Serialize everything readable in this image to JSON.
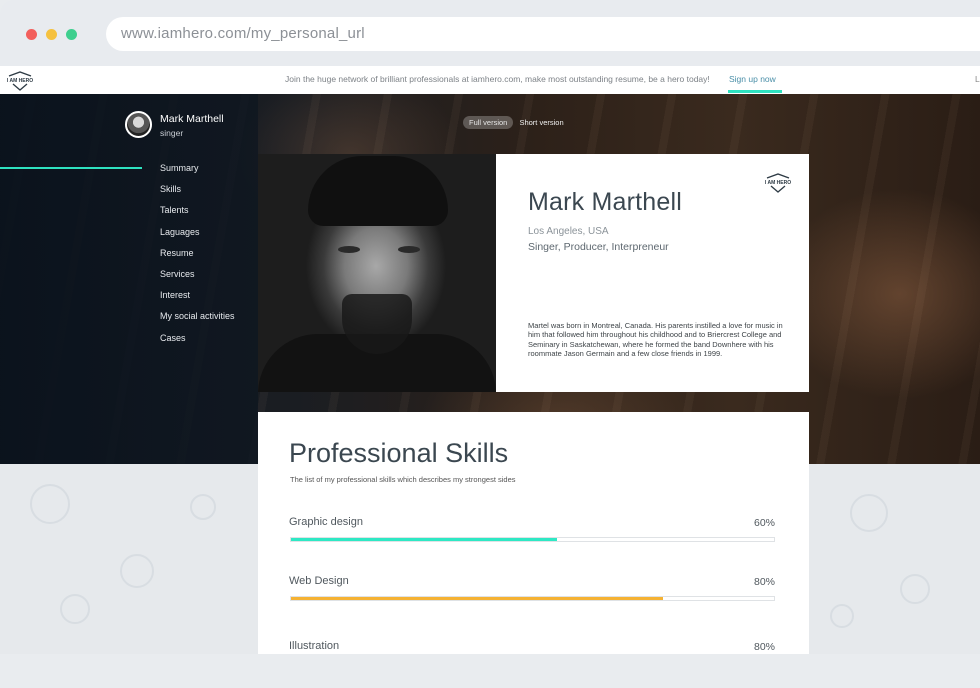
{
  "browser": {
    "url": "www.iamhero.com/my_personal_url"
  },
  "topbar": {
    "logo_text": "I AM HERO",
    "message": "Join the huge network of brilliant professionals at iamhero.com, make most outstanding resume, be a hero today!",
    "signup_label": "Sign up now",
    "right_text": "L"
  },
  "profile": {
    "name": "Mark Marthell",
    "role": "singer"
  },
  "nav": {
    "items": [
      "Summary",
      "Skills",
      "Talents",
      "Laguages",
      "Resume",
      "Services",
      "Interest",
      "My social activities",
      "Cases"
    ],
    "active": "Summary"
  },
  "version": {
    "full": "Full version",
    "short": "Short version"
  },
  "card": {
    "logo_text": "I AM HERO",
    "name": "Mark Marthell",
    "location": "Los Angeles, USA",
    "title": "Singer, Producer, Interpreneur",
    "bio": "Martel was born in Montreal, Canada. His parents instilled a love for music in him that followed him throughout his childhood and to Briercrest College and Seminary in Saskatchewan, where he formed the band Downhere with his roommate Jason Germain and a few close friends in 1999."
  },
  "skills": {
    "title": "Professional Skills",
    "subtitle": "The list of my professional skills which describes my strongest sides",
    "items": [
      {
        "label": "Graphic design",
        "percent": "60%",
        "fill": 0.55,
        "color": "#2ee8c4"
      },
      {
        "label": "Web Design",
        "percent": "80%",
        "fill": 0.77,
        "color": "#f5b233"
      },
      {
        "label": "Illustration",
        "percent": "80%",
        "fill": 0.8,
        "color": "#2ee8c4"
      }
    ]
  },
  "colors": {
    "accent": "#2ee2c0",
    "orange": "#f5b233",
    "link": "#4a8fa8"
  }
}
